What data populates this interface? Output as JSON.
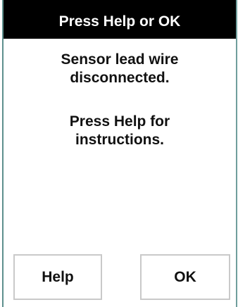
{
  "dialog": {
    "title": "Press Help or OK",
    "message_line1": "Sensor lead wire",
    "message_line2": "disconnected.",
    "instruction_line1": "Press Help for",
    "instruction_line2": "instructions."
  },
  "buttons": {
    "help_label": "Help",
    "ok_label": "OK"
  }
}
